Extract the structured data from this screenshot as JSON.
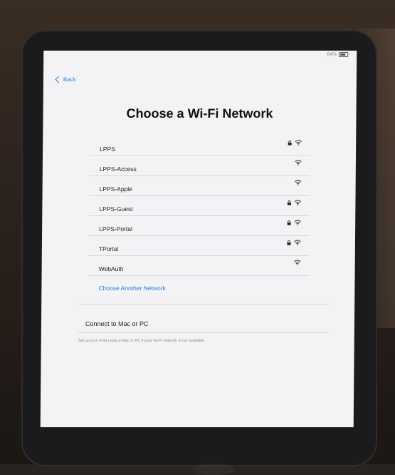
{
  "status_bar": {
    "battery_label": "64%"
  },
  "nav": {
    "back_label": "Back"
  },
  "title": "Choose a Wi-Fi Network",
  "networks": [
    {
      "name": "LPPS",
      "locked": true,
      "icon": "wifi-icon"
    },
    {
      "name": "LPPS-Access",
      "locked": false,
      "icon": "wifi-icon"
    },
    {
      "name": "LPPS-Apple",
      "locked": false,
      "icon": "wifi-icon"
    },
    {
      "name": "LPPS-Guest",
      "locked": true,
      "icon": "wifi-icon"
    },
    {
      "name": "LPPS-Portal",
      "locked": true,
      "icon": "wifi-icon"
    },
    {
      "name": "TPortal",
      "locked": true,
      "icon": "wifi-icon"
    },
    {
      "name": "WebAuth",
      "locked": false,
      "icon": "wifi-icon"
    }
  ],
  "other_network_label": "Choose Another Network",
  "connect_label": "Connect to Mac or PC",
  "footer_text": "Set up your iPad using a Mac or PC if your Wi-Fi network is not available.",
  "colors": {
    "accent": "#2a7de1",
    "screen_bg": "#f3f3f5",
    "bezel": "#1b1b1d"
  }
}
